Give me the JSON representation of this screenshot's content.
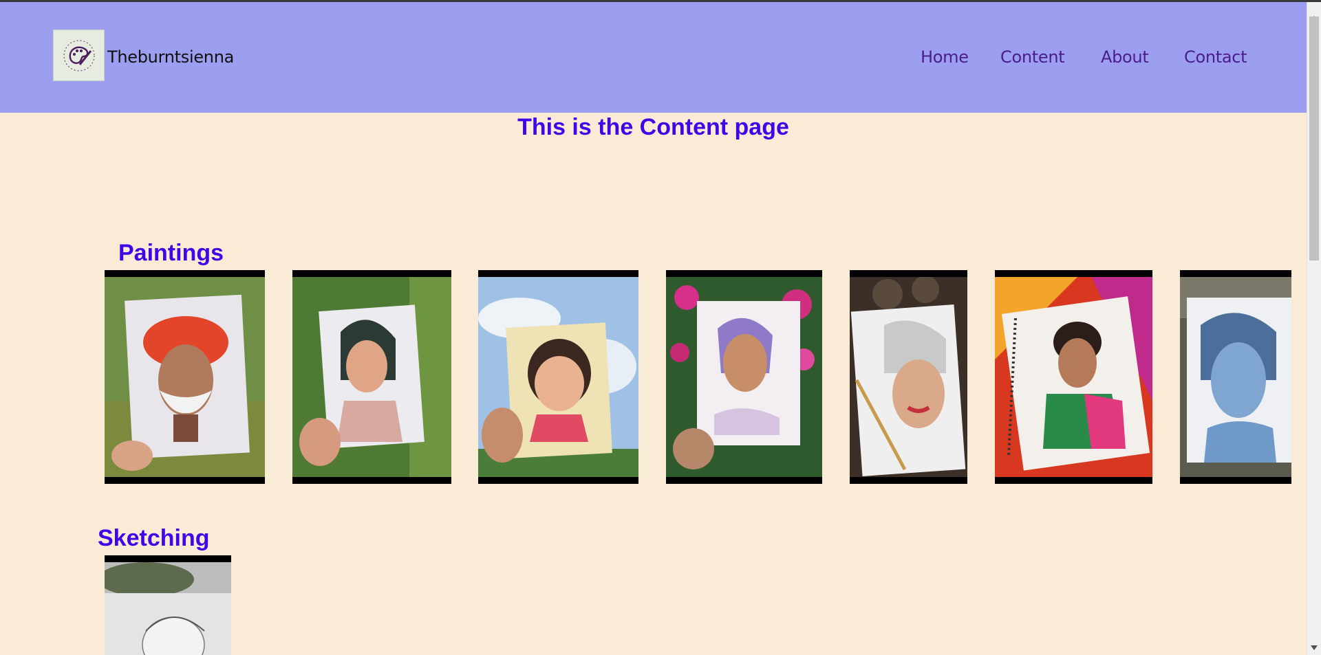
{
  "header": {
    "brand": "Theburntsienna",
    "logo_icon": "palette-logo-icon",
    "nav": {
      "home": "Home",
      "content": "Content",
      "about": "About",
      "contact": "Contact"
    }
  },
  "main": {
    "title": "This is the Content page",
    "sections": {
      "paintings": "Paintings",
      "sketching": "Sketching"
    }
  },
  "colors": {
    "header_bg": "#9c9ef0",
    "page_bg": "#faebd7",
    "heading": "#3d07e8",
    "nav_text": "#4b1d8c"
  }
}
